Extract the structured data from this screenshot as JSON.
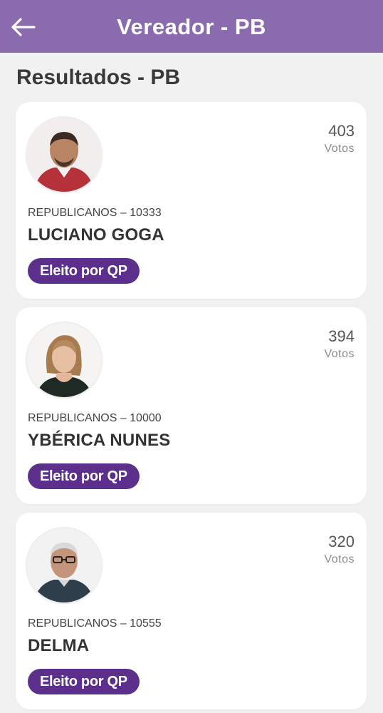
{
  "header": {
    "title": "Vereador - PB",
    "back_icon": "arrow-left-icon",
    "background_color": "#8a6cae"
  },
  "page": {
    "heading": "Resultados - PB"
  },
  "candidates": [
    {
      "votes": "403",
      "votes_label": "Votos",
      "party_number": "REPUBLICANOS – 10333",
      "name": "LUCIANO GOGA",
      "status": "Eleito por QP"
    },
    {
      "votes": "394",
      "votes_label": "Votos",
      "party_number": "REPUBLICANOS – 10000",
      "name": "YBÉRICA NUNES",
      "status": "Eleito por QP"
    },
    {
      "votes": "320",
      "votes_label": "Votos",
      "party_number": "REPUBLICANOS – 10555",
      "name": "DELMA",
      "status": "Eleito por QP"
    }
  ],
  "colors": {
    "badge": "#5d2f8c",
    "page_background": "#f1f1f2"
  }
}
